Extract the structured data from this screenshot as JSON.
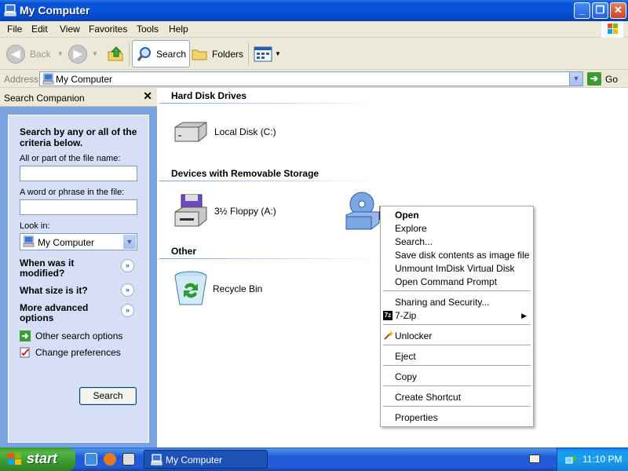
{
  "window": {
    "title": "My Computer",
    "controls": {
      "minimize": "_",
      "maximize": "❐",
      "close": "✕"
    }
  },
  "menubar": {
    "items": [
      "File",
      "Edit",
      "View",
      "Favorites",
      "Tools",
      "Help"
    ]
  },
  "toolbar": {
    "back": "Back",
    "search": "Search",
    "folders": "Folders"
  },
  "address": {
    "label": "Address",
    "value": "My Computer",
    "go": "Go"
  },
  "search_companion": {
    "title": "Search Companion",
    "heading": "Search by any or all of the criteria below.",
    "filename_label": "All or part of the file name:",
    "filename_value": "",
    "phrase_label": "A word or phrase in the file:",
    "phrase_value": "",
    "lookin_label": "Look in:",
    "lookin_value": "My Computer",
    "q_modified": "When was it modified?",
    "q_size": "What size is it?",
    "q_advanced": "More advanced options",
    "other_options": "Other search options",
    "change_prefs": "Change preferences",
    "search_button": "Search"
  },
  "main": {
    "groups": [
      {
        "heading": "Hard Disk Drives",
        "items": [
          "Local Disk (C:)"
        ]
      },
      {
        "heading": "Devices with Removable Storage",
        "items": [
          "3½ Floppy (A:)"
        ]
      },
      {
        "heading": "Other",
        "items": [
          "Recycle Bin"
        ]
      }
    ]
  },
  "context_menu": {
    "items": [
      "Open",
      "Explore",
      "Search...",
      "Save disk contents as image file",
      "Unmount ImDisk Virtual Disk",
      "Open Command Prompt",
      "Sharing and Security...",
      "7-Zip",
      "Unlocker",
      "Eject",
      "Copy",
      "Create Shortcut",
      "Properties"
    ]
  },
  "taskbar": {
    "start": "start",
    "task": "My Computer",
    "clock": "11:10 PM"
  }
}
